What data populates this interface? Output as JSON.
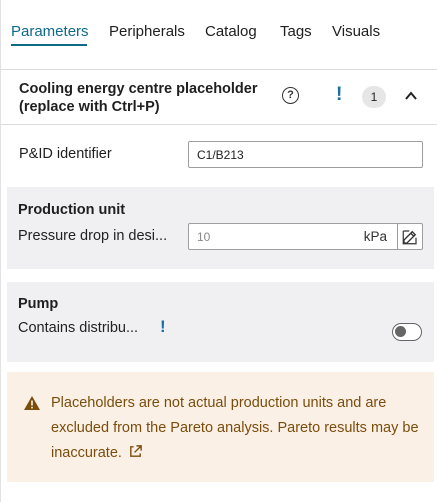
{
  "tabs": [
    {
      "label": "Parameters",
      "active": true
    },
    {
      "label": "Peripherals",
      "active": false
    },
    {
      "label": "Catalog",
      "active": false
    },
    {
      "label": "Tags",
      "active": false
    },
    {
      "label": "Visuals",
      "active": false
    }
  ],
  "header": {
    "title_line1": "Cooling energy centre placeholder",
    "title_line2": "(replace with Ctrl+P)",
    "help_icon": "?",
    "warning_mark": "!",
    "badge_count": "1",
    "collapse_icon": "chevron-up-icon"
  },
  "pid": {
    "label": "P&ID identifier",
    "value": "C1/B213"
  },
  "production_unit": {
    "title": "Production unit",
    "pressure_label": "Pressure drop in desi...",
    "pressure_value": "10",
    "pressure_unit": "kPa",
    "edit_icon": "edit-icon"
  },
  "pump": {
    "title": "Pump",
    "contains_label": "Contains distribu...",
    "warning_mark": "!",
    "toggle_on": false
  },
  "banner": {
    "icon": "warning-triangle-icon",
    "text": "Placeholders are not actual production units and are excluded from the Pareto analysis. Pareto results may be inaccurate.",
    "link_icon": "external-link-icon"
  },
  "colors": {
    "accent": "#0f6a8a",
    "warning_blue": "#1a6fa0",
    "banner_bg": "#fbf0e6",
    "banner_text": "#7a4d0c",
    "panel_bg": "#f0f0f2"
  }
}
